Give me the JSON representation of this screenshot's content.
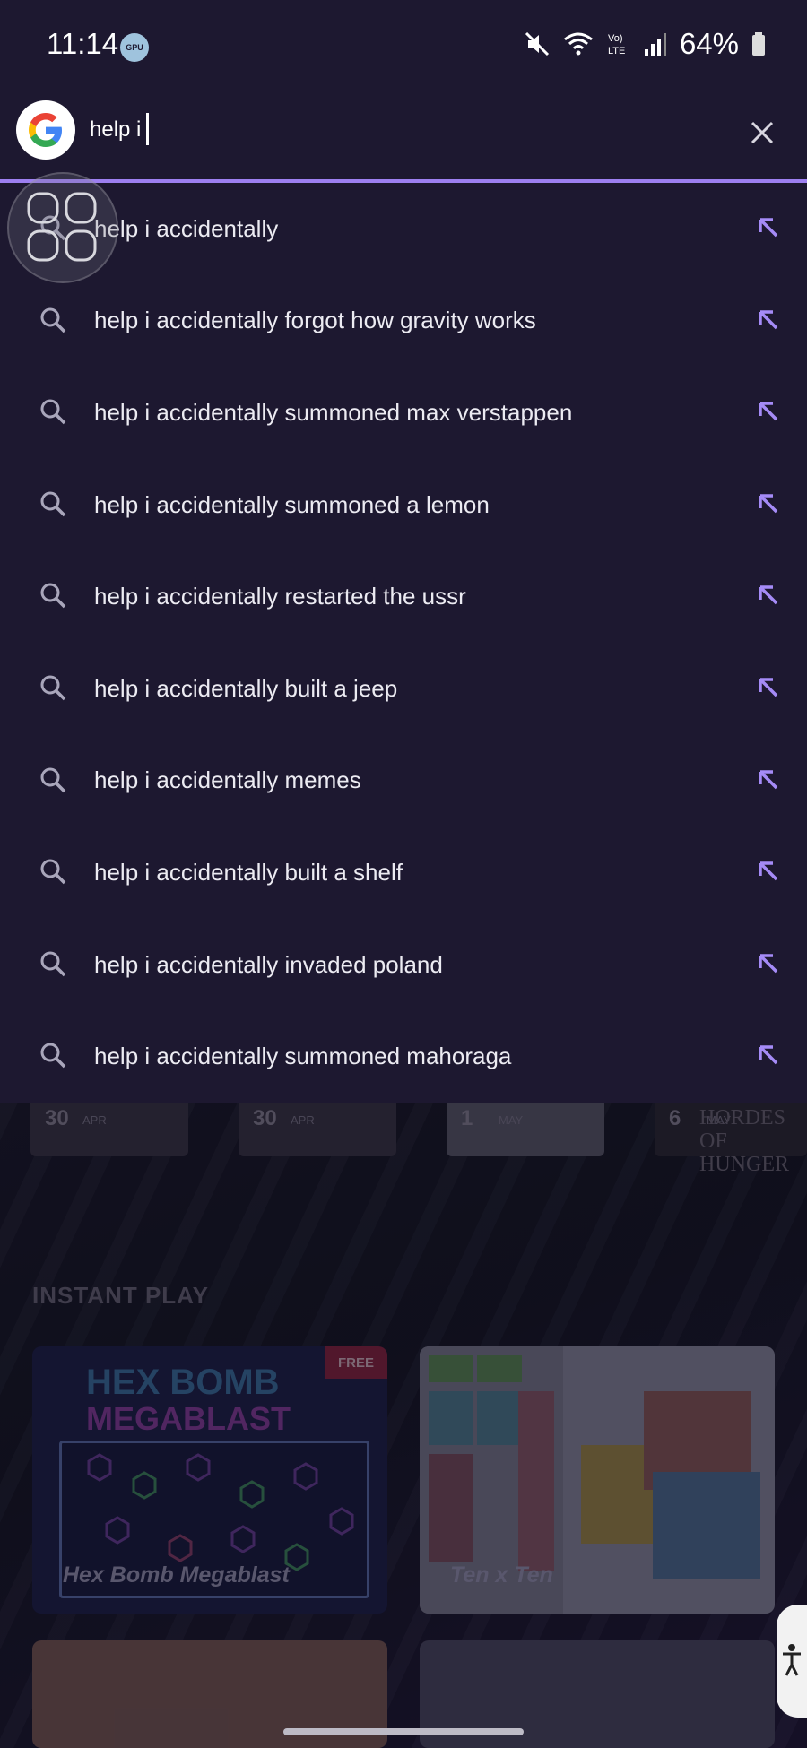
{
  "status_bar": {
    "time": "11:14",
    "gpu_badge": "GPU",
    "battery": "64%"
  },
  "search": {
    "value": "help i",
    "clear_icon": "close-icon",
    "accent_color": "#9d7ff0"
  },
  "suggestions": [
    "help i accidentally",
    "help i accidentally forgot how gravity works",
    "help i accidentally summoned max verstappen",
    "help i accidentally summoned a lemon",
    "help i accidentally restarted the ussr",
    "help i accidentally built a jeep",
    "help i accidentally memes",
    "help i accidentally built a shelf",
    "help i accidentally invaded poland",
    "help i accidentally summoned mahoraga"
  ],
  "background_app": {
    "dates": [
      {
        "day": "30",
        "month": "APR"
      },
      {
        "day": "30",
        "month": "APR"
      },
      {
        "day": "1",
        "month": "MAY"
      },
      {
        "day": "6",
        "month": "MAY"
      }
    ],
    "hordes_logo": "HORDES OF HUNGER",
    "section_title": "INSTANT PLAY",
    "games": [
      {
        "title": "Hex Bomb Megablast",
        "badge": "FREE",
        "art_title_1": "HEX BOMB",
        "art_title_2": "MEGABLAST"
      },
      {
        "title": "Ten x Ten"
      }
    ]
  }
}
